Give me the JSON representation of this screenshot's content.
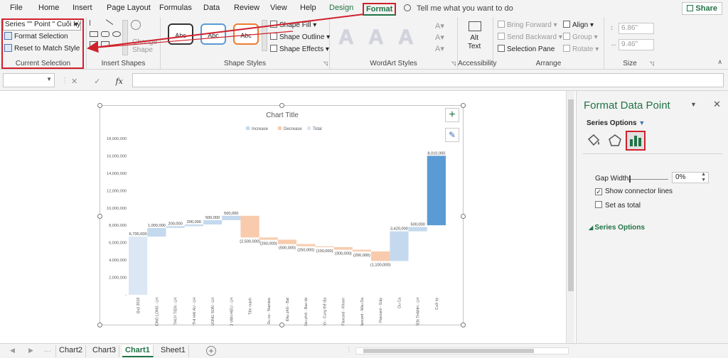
{
  "tabs": [
    "File",
    "Home",
    "Insert",
    "Page Layout",
    "Formulas",
    "Data",
    "Review",
    "View",
    "Help",
    "Design",
    "Format"
  ],
  "tell_me": "Tell me what you want to do",
  "share": "Share",
  "ribbon": {
    "current_selection": {
      "dropdown": "Series \"\" Point \" Cuối kỳ",
      "format_selection": "Format Selection",
      "reset": "Reset to Match Style",
      "label": "Current Selection"
    },
    "insert_shapes": {
      "change_shape": "Change\nShape",
      "label": "Insert Shapes"
    },
    "shape_styles": {
      "sample": "Abc",
      "fill": "Shape Fill",
      "outline": "Shape Outline",
      "effects": "Shape Effects",
      "label": "Shape Styles"
    },
    "wordart": {
      "letter": "A",
      "label": "WordArt Styles"
    },
    "accessibility": {
      "alt_text": "Alt\nText",
      "label": "Accessibility"
    },
    "arrange": {
      "bring_forward": "Bring Forward",
      "send_backward": "Send Backward",
      "selection_pane": "Selection Pane",
      "align": "Align",
      "group": "Group",
      "rotate": "Rotate",
      "label": "Arrange"
    },
    "size": {
      "height": "6.86\"",
      "width": "9.46\"",
      "label": "Size"
    }
  },
  "formula_bar": {
    "fx": "fx",
    "x": "✕",
    "check": "✓"
  },
  "pane": {
    "title": "Format Data Point",
    "series_options_head": "Series Options",
    "section": "Series Options",
    "gap_width_label": "Gap Width",
    "gap_width_value": "0%",
    "show_connector": "Show connector lines",
    "show_connector_checked": true,
    "set_as_total": "Set as total",
    "set_as_total_checked": false
  },
  "sheet_tabs": [
    "Chart2",
    "Chart3",
    "Chart1",
    "Sheet1"
  ],
  "active_sheet": "Chart1",
  "chart_data": {
    "type": "bar",
    "title": "Chart Title",
    "legend": [
      "Increase",
      "Decrease",
      "Total"
    ],
    "legend_position": "top",
    "colors": {
      "Increase": "#c5d9ee",
      "Decrease": "#f8cbad",
      "Total": "#5b9bd5",
      "TotalFaded": "#dbe7f4"
    },
    "categories": [
      "Quỹ 2018",
      "YEN PHONG LONG - LH",
      "NGUYEN THUY TIEN - LH",
      "PHAM THI HAI AU - LH",
      "ANG TRUONG SON - LH",
      "NGO VAN HIEU - LH",
      "Tiền mạnh",
      "Du ca - Standee",
      "Đầu phối - Bạt",
      "Đầu phối - Bao tải",
      "Điều phối - Cung thể địa",
      "Flaxcard - Khoen",
      "Flaxcard - Màu Da",
      "Flaxcard - Giấy",
      "Du Ca",
      "TRAN TIEN THANH - LH",
      "Cuối kỳ"
    ],
    "values": [
      6700000,
      1000000,
      200000,
      200000,
      500000,
      500000,
      -2500000,
      -260000,
      -500000,
      -250000,
      -100000,
      -300000,
      -200000,
      -1100000,
      3420000,
      500000,
      8010000
    ],
    "kinds": [
      "total-faded",
      "inc",
      "inc",
      "inc",
      "inc",
      "inc",
      "dec",
      "dec",
      "dec",
      "dec",
      "dec",
      "dec",
      "dec",
      "dec",
      "inc",
      "inc",
      "total"
    ],
    "labels": [
      "6,700,000",
      "1,000,000",
      "200,000",
      "200,000",
      "500,000",
      "500,000",
      "(2,500,000)",
      "(260,000)",
      "(500,000)",
      "(250,000)",
      "(100,000)",
      "(300,000)",
      "(200,000)",
      "(1,100,000)",
      "3,420,000",
      "500,000",
      "8,010,000"
    ],
    "y_ticks": [
      "-",
      "2,000,000",
      "4,000,000",
      "6,000,000",
      "8,000,000",
      "10,000,000",
      "12,000,000",
      "14,000,000",
      "16,000,000",
      "18,000,000"
    ],
    "ylim": [
      0,
      18000000
    ],
    "grid": false
  }
}
